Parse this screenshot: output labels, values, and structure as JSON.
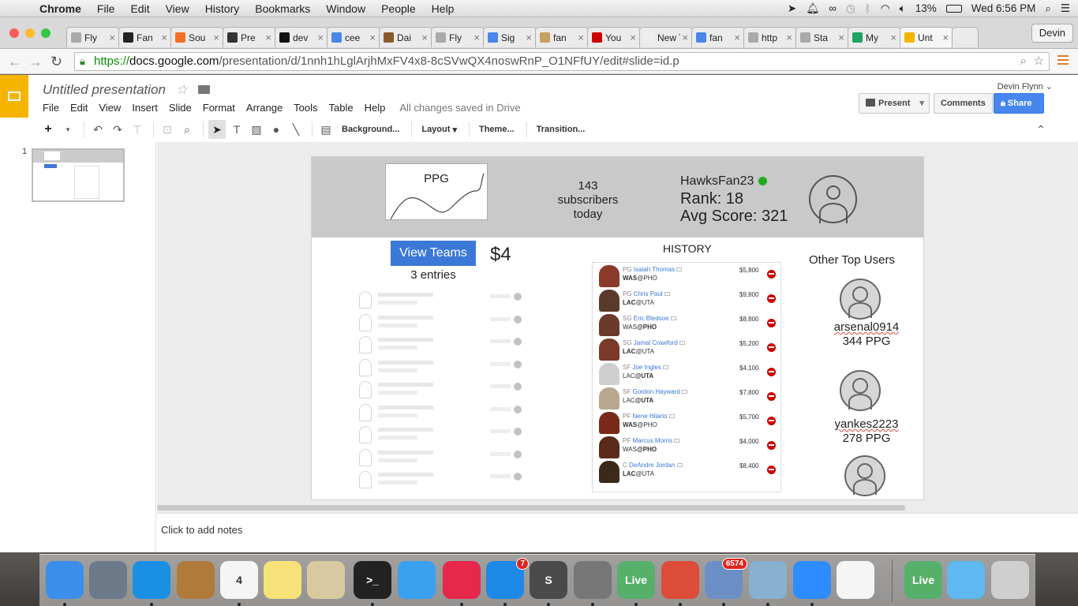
{
  "menubar": {
    "app": "Chrome",
    "items": [
      "File",
      "Edit",
      "View",
      "History",
      "Bookmarks",
      "Window",
      "People",
      "Help"
    ],
    "battery": "13%",
    "clock": "Wed 6:56 PM"
  },
  "tabs": [
    {
      "label": "Fly",
      "color": "#aaa"
    },
    {
      "label": "Fan",
      "color": "#222"
    },
    {
      "label": "Sou",
      "color": "#f26f23"
    },
    {
      "label": "Pre",
      "color": "#333"
    },
    {
      "label": "dev",
      "color": "#111"
    },
    {
      "label": "cee",
      "color": "#4a86e8"
    },
    {
      "label": "Dai",
      "color": "#8b5a2b"
    },
    {
      "label": "Fly",
      "color": "#aaa"
    },
    {
      "label": "Sig",
      "color": "#4a86e8"
    },
    {
      "label": "fan",
      "color": "#c8a060"
    },
    {
      "label": "You",
      "color": "#cc0000"
    },
    {
      "label": "New T",
      "color": "#eee"
    },
    {
      "label": "fan",
      "color": "#4a86e8"
    },
    {
      "label": "http",
      "color": "#aaa"
    },
    {
      "label": "Sta",
      "color": "#aaa"
    },
    {
      "label": "My",
      "color": "#1fa463"
    },
    {
      "label": "Unt",
      "color": "#f4b400"
    }
  ],
  "profile": "Devin",
  "url": {
    "scheme": "https://",
    "host": "docs.google.com",
    "path": "/presentation/d/1nnh1hLglArjhMxFV4x8-8cSVwQX4noswRnP_O1NFfUY/edit#slide=id.p"
  },
  "docs": {
    "title": "Untitled presentation",
    "menu": [
      "File",
      "Edit",
      "View",
      "Insert",
      "Slide",
      "Format",
      "Arrange",
      "Tools",
      "Table",
      "Help"
    ],
    "saved": "All changes saved in Drive",
    "user": "Devin Flynn",
    "present": "Present",
    "comments": "Comments",
    "share": "Share",
    "toolbar": {
      "background": "Background...",
      "layout": "Layout",
      "theme": "Theme...",
      "transition": "Transition..."
    },
    "slide_number": "1",
    "notes": "Click to add notes"
  },
  "slide": {
    "ppg_label": "PPG",
    "subscribers": [
      "143",
      "subscribers",
      "today"
    ],
    "user": {
      "name": "HawksFan23",
      "rank": "Rank: 18",
      "avg": "Avg Score: 321"
    },
    "view_teams": "View Teams",
    "price": "$4",
    "entries": "3 entries",
    "history_title": "HISTORY",
    "history": [
      {
        "pos": "PG",
        "name": "Isaiah Thomas",
        "m1": "WAS",
        "m2": "@PHO",
        "bold": "m1",
        "salary": "$5,800",
        "pic": "#8b3a2a"
      },
      {
        "pos": "PG",
        "name": "Chris Paul",
        "m1": "LAC",
        "m2": "@UTA",
        "bold": "m1",
        "salary": "$9,800",
        "pic": "#5a3a2a"
      },
      {
        "pos": "SG",
        "name": "Eric Bledsoe",
        "m1": "WAS",
        "m2": "@PHO",
        "bold": "m2",
        "salary": "$8,800",
        "pic": "#6a3a2a"
      },
      {
        "pos": "SG",
        "name": "Jamal Crawford",
        "m1": "LAC",
        "m2": "@UTA",
        "bold": "m1",
        "salary": "$5,200",
        "pic": "#7a3a2a"
      },
      {
        "pos": "SF",
        "name": "Joe Ingles",
        "m1": "LAC",
        "m2": "@UTA",
        "bold": "m2",
        "salary": "$4,100",
        "pic": "#cfcfcf"
      },
      {
        "pos": "SF",
        "name": "Gordon Hayward",
        "m1": "LAC",
        "m2": "@UTA",
        "bold": "m2",
        "salary": "$7,800",
        "pic": "#b8a88f"
      },
      {
        "pos": "PF",
        "name": "Nene Hilario",
        "m1": "WAS",
        "m2": "@PHO",
        "bold": "m1",
        "salary": "$5,700",
        "pic": "#7a2a1a"
      },
      {
        "pos": "PF",
        "name": "Marcus Morris",
        "m1": "WAS",
        "m2": "@PHO",
        "bold": "m2",
        "salary": "$4,000",
        "pic": "#5a2a1a"
      },
      {
        "pos": "C",
        "name": "DeAndre Jordan",
        "m1": "LAC",
        "m2": "@UTA",
        "bold": "m1",
        "salary": "$8,400",
        "pic": "#3a2a1a"
      }
    ],
    "other_title": "Other Top Users",
    "others": [
      {
        "name": "arsenal0914",
        "ppg": "344 PPG"
      },
      {
        "name": "yankes2223",
        "ppg": "278 PPG"
      }
    ]
  },
  "dock": [
    {
      "name": "finder-icon",
      "color": "#3b8eea",
      "label": ""
    },
    {
      "name": "launchpad-icon",
      "color": "#6d7a8a",
      "label": ""
    },
    {
      "name": "safari-icon",
      "color": "#1a8fe3",
      "label": ""
    },
    {
      "name": "contacts-icon",
      "color": "#b07a3a",
      "label": ""
    },
    {
      "name": "calendar-icon",
      "color": "#f5f5f5",
      "label": "4"
    },
    {
      "name": "notes-icon",
      "color": "#f7e27a",
      "label": ""
    },
    {
      "name": "preview-icon",
      "color": "#d9c9a0",
      "label": ""
    },
    {
      "name": "terminal-icon",
      "color": "#222",
      "label": ">_"
    },
    {
      "name": "messages-icon",
      "color": "#3aa0f0",
      "label": ""
    },
    {
      "name": "itunes-icon",
      "color": "#e6284a",
      "label": ""
    },
    {
      "name": "app-store-icon",
      "color": "#1e88e5",
      "label": "",
      "badge": "7"
    },
    {
      "name": "sublime-icon",
      "color": "#4a4a4a",
      "label": "S"
    },
    {
      "name": "system-preferences-icon",
      "color": "#777",
      "label": ""
    },
    {
      "name": "livereload-icon",
      "color": "#57b06a",
      "label": "Live"
    },
    {
      "name": "chrome-icon",
      "color": "#dd4b39",
      "label": ""
    },
    {
      "name": "mail-icon",
      "color": "#6b8fc4",
      "label": "",
      "badge": "6574"
    },
    {
      "name": "iphoto-icon",
      "color": "#8ab0d0",
      "label": ""
    },
    {
      "name": "zoom-icon",
      "color": "#2d8cff",
      "label": ""
    },
    {
      "name": "orange-app-icon",
      "color": "#f5f5f5",
      "label": ""
    },
    {
      "name": "livereload-2-icon",
      "color": "#57b06a",
      "label": "Live"
    },
    {
      "name": "folder-icon",
      "color": "#5fb8f0",
      "label": ""
    },
    {
      "name": "trash-icon",
      "color": "#cfcfcf",
      "label": ""
    }
  ]
}
